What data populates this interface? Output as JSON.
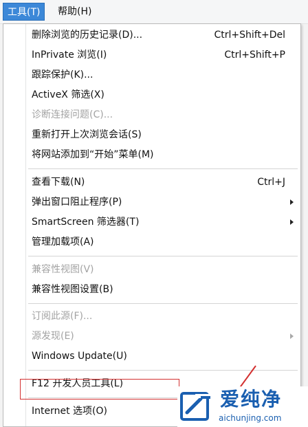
{
  "menubar": {
    "items": [
      {
        "label": "工具(T)",
        "active": true
      },
      {
        "label": "帮助(H)",
        "active": false
      }
    ]
  },
  "tools_menu": {
    "items": [
      {
        "label": "删除浏览的历史记录(D)...",
        "shortcut": "Ctrl+Shift+Del",
        "disabled": false,
        "submenu": false
      },
      {
        "label": "InPrivate 浏览(I)",
        "shortcut": "Ctrl+Shift+P",
        "disabled": false,
        "submenu": false
      },
      {
        "label": "跟踪保护(K)...",
        "shortcut": "",
        "disabled": false,
        "submenu": false
      },
      {
        "label": "ActiveX 筛选(X)",
        "shortcut": "",
        "disabled": false,
        "submenu": false
      },
      {
        "label": "诊断连接问题(C)...",
        "shortcut": "",
        "disabled": true,
        "submenu": false
      },
      {
        "label": "重新打开上次浏览会话(S)",
        "shortcut": "",
        "disabled": false,
        "submenu": false
      },
      {
        "label": "将网站添加到“开始”菜单(M)",
        "shortcut": "",
        "disabled": false,
        "submenu": false
      },
      {
        "label": "查看下载(N)",
        "shortcut": "Ctrl+J",
        "disabled": false,
        "submenu": false
      },
      {
        "label": "弹出窗口阻止程序(P)",
        "shortcut": "",
        "disabled": false,
        "submenu": true
      },
      {
        "label": "SmartScreen 筛选器(T)",
        "shortcut": "",
        "disabled": false,
        "submenu": true
      },
      {
        "label": "管理加载项(A)",
        "shortcut": "",
        "disabled": false,
        "submenu": false
      },
      {
        "label": "兼容性视图(V)",
        "shortcut": "",
        "disabled": true,
        "submenu": false
      },
      {
        "label": "兼容性视图设置(B)",
        "shortcut": "",
        "disabled": false,
        "submenu": false
      },
      {
        "label": "订阅此源(F)...",
        "shortcut": "",
        "disabled": true,
        "submenu": false
      },
      {
        "label": "源发现(E)",
        "shortcut": "",
        "disabled": true,
        "submenu": true
      },
      {
        "label": "Windows Update(U)",
        "shortcut": "",
        "disabled": false,
        "submenu": false
      },
      {
        "label": "F12 开发人员工具(L)",
        "shortcut": "",
        "disabled": false,
        "submenu": false
      },
      {
        "label": "Internet 选项(O)",
        "shortcut": "",
        "disabled": false,
        "submenu": false,
        "highlighted": true
      }
    ]
  },
  "watermark": {
    "name": "爱纯净",
    "url": "aichunjing.com"
  },
  "colors": {
    "menubar_active": "#3c88d8",
    "disabled_text": "#a3a3a3",
    "highlight_border": "#d33030",
    "watermark_blue": "#1a5fb0"
  }
}
